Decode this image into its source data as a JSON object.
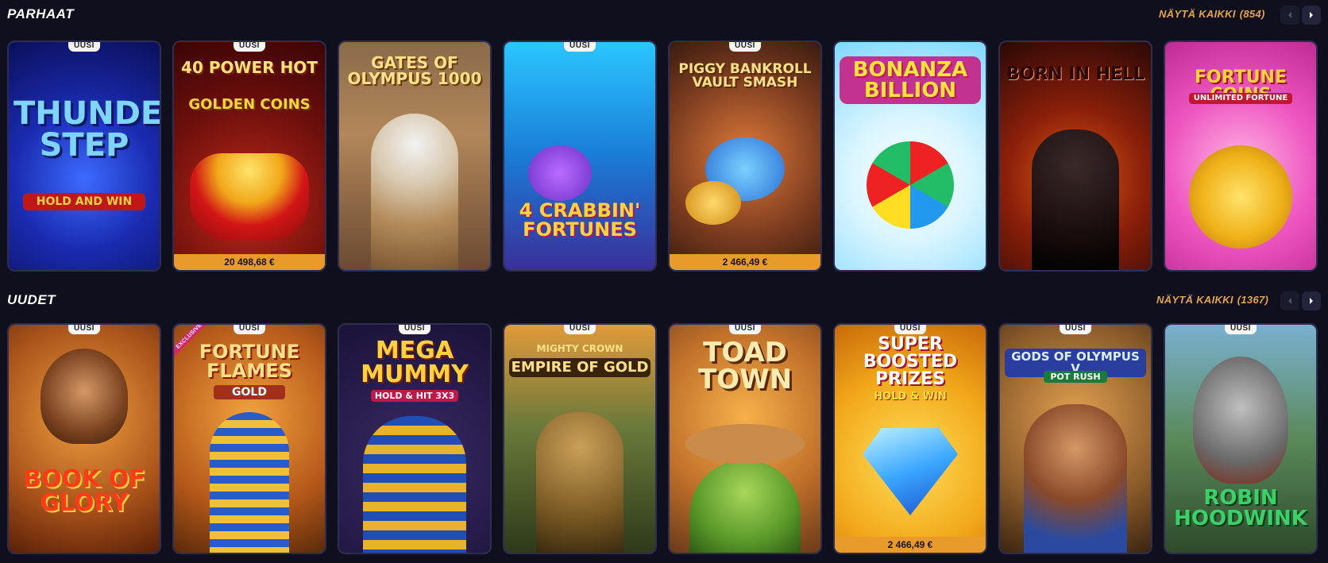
{
  "sections": [
    {
      "title": "PARHAAT",
      "view_all": "NÄYTÄ KAIKKI",
      "count": "(854)",
      "games": [
        {
          "name": "THUNDER STEP",
          "sub": "HOLD AND WIN",
          "badge": "UUSI",
          "jackpot": ""
        },
        {
          "name": "40 POWER HOT",
          "sub": "GOLDEN COINS",
          "badge": "UUSI",
          "jackpot": "20 498,68 €"
        },
        {
          "name": "GATES OF OLYMPUS 1000",
          "sub": "",
          "badge": "",
          "jackpot": ""
        },
        {
          "name": "4 CRABBIN' FORTUNES",
          "sub": "",
          "badge": "UUSI",
          "jackpot": ""
        },
        {
          "name": "PIGGY BANKROLL VAULT SMASH",
          "sub": "",
          "badge": "UUSI",
          "jackpot": "2 466,49 €"
        },
        {
          "name": "BONANZA BILLION",
          "sub": "",
          "badge": "",
          "jackpot": ""
        },
        {
          "name": "BORN IN HELL",
          "sub": "",
          "badge": "",
          "jackpot": ""
        },
        {
          "name": "FORTUNE COINS",
          "sub": "UNLIMITED FORTUNE",
          "badge": "",
          "jackpot": ""
        }
      ]
    },
    {
      "title": "UUDET",
      "view_all": "NÄYTÄ KAIKKI",
      "count": "(1367)",
      "games": [
        {
          "name": "BOOK OF GLORY",
          "sub": "",
          "badge": "UUSI",
          "jackpot": ""
        },
        {
          "name": "FORTUNE FLAMES",
          "sub": "GOLD",
          "badge": "UUSI",
          "jackpot": "",
          "exclusive": "EXCLUSIVE"
        },
        {
          "name": "MEGA MUMMY",
          "sub": "HOLD & HIT 3x3",
          "badge": "UUSI",
          "jackpot": ""
        },
        {
          "name": "EMPIRE OF GOLD",
          "sub": "MIGHTY CROWN",
          "badge": "UUSI",
          "jackpot": ""
        },
        {
          "name": "TOAD TOWN",
          "sub": "",
          "badge": "UUSI",
          "jackpot": ""
        },
        {
          "name": "SUPER BOOSTED PRIZES",
          "sub": "HOLD & WIN",
          "badge": "UUSI",
          "jackpot": "2 466,49 €"
        },
        {
          "name": "GODS OF OLYMPUS V",
          "sub": "POT RUSH",
          "badge": "UUSI",
          "jackpot": ""
        },
        {
          "name": "ROBIN HOODWINK",
          "sub": "",
          "badge": "UUSI",
          "jackpot": ""
        }
      ]
    }
  ],
  "colors": {
    "background": "#0f0f1e",
    "accent": "#e3a44a",
    "jackpot": "#e89b2a"
  }
}
